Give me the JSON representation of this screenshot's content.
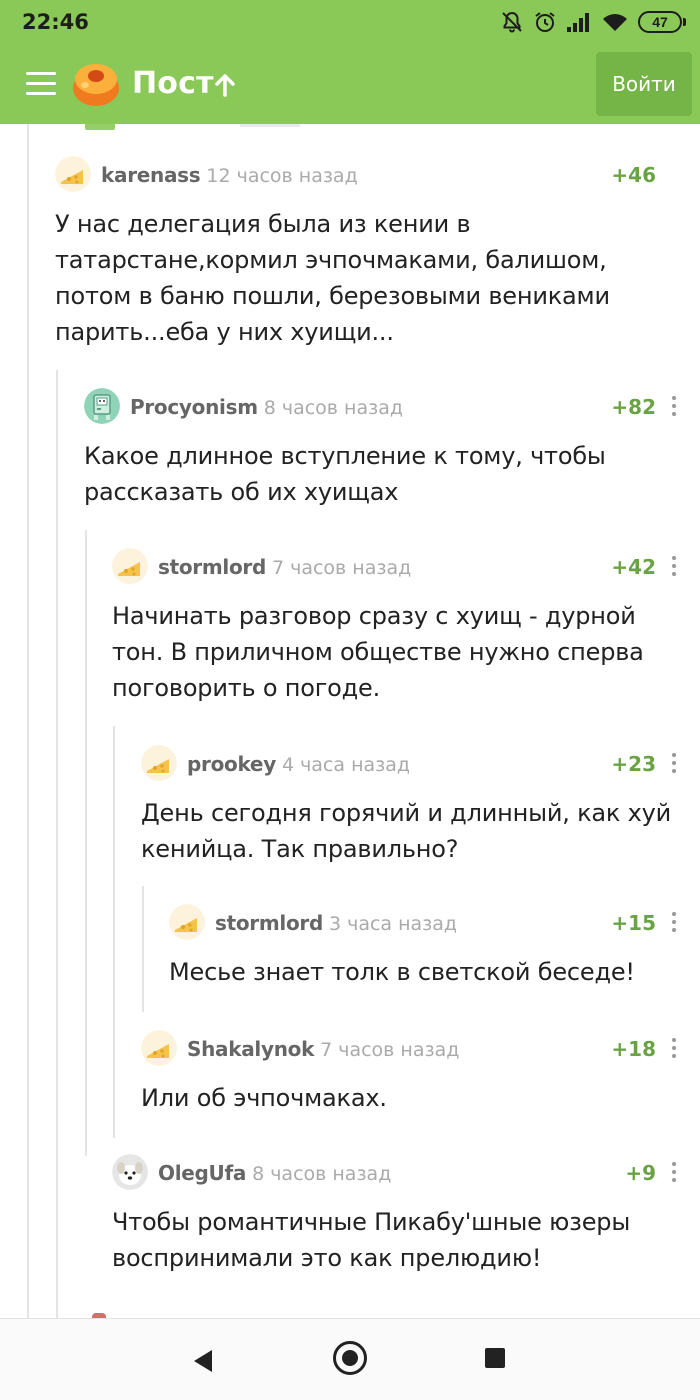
{
  "status_bar": {
    "time": "22:46",
    "battery": "47"
  },
  "app_bar": {
    "title": "Пост",
    "login_label": "Войти"
  },
  "colors": {
    "brand_green": "#8ac858",
    "rating_green": "#6aa343",
    "login_button": "#75b548"
  },
  "comments": [
    {
      "author": "karenass",
      "time": "12 часов назад",
      "rating": "+46",
      "text": "У нас делегация была из кении в татарстане,кормил эчпочмаками, балишом, потом в баню пошли, березовыми вениками парить...еба у них хуищи...",
      "avatar": "cheese-avatar-icon"
    },
    {
      "author": "Procyonism",
      "time": "8 часов назад",
      "rating": "+82",
      "text": "Какое длинное вступление к тому, чтобы рассказать об их хуищах",
      "avatar": "robot-avatar-icon"
    },
    {
      "author": "stormlord",
      "time": "7 часов назад",
      "rating": "+42",
      "text": "Начинать разговор сразу с хуищ - дурной тон. В приличном обществе нужно сперва поговорить о погоде.",
      "avatar": "cheese-avatar-icon"
    },
    {
      "author": "prookey",
      "time": "4 часа назад",
      "rating": "+23",
      "text": "День сегодня горячий и длинный, как хуй кенийца. Так правильно?",
      "avatar": "cheese-avatar-icon"
    },
    {
      "author": "stormlord",
      "time": "3 часа назад",
      "rating": "+15",
      "text": "Месье знает толк в светской беседе!",
      "avatar": "cheese-avatar-icon"
    },
    {
      "author": "Shakalynok",
      "time": "7 часов назад",
      "rating": "+18",
      "text": "Или об эчпочмаках.",
      "avatar": "cheese-avatar-icon"
    },
    {
      "author": "OlegUfa",
      "time": "8 часов назад",
      "rating": "+9",
      "text": "Чтобы романтичные Пикабу'шные юзеры воспринимали это как прелюдию!",
      "avatar": "dog-avatar-icon"
    }
  ]
}
